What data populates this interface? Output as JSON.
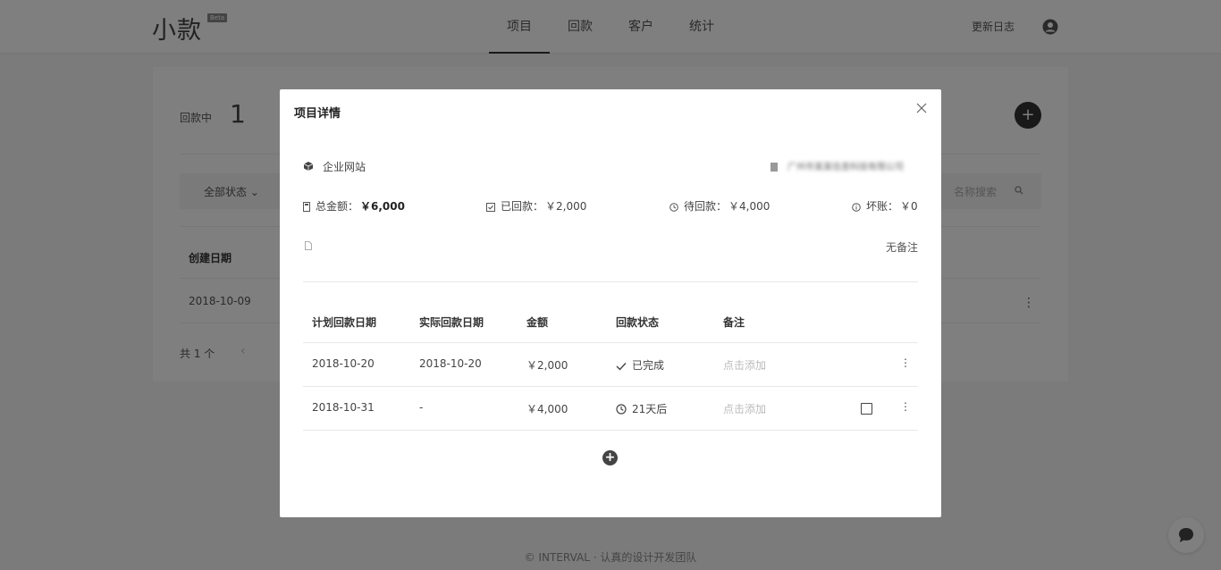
{
  "app": {
    "logo": "小款",
    "beta_badge": "Beta"
  },
  "nav": {
    "tabs": [
      {
        "label": "项目",
        "active": true
      },
      {
        "label": "回款",
        "active": false
      },
      {
        "label": "客户",
        "active": false
      },
      {
        "label": "统计",
        "active": false
      }
    ],
    "changelog": "更新日志",
    "user_icon": "user-circle-icon"
  },
  "page": {
    "in_progress_label": "回款中",
    "in_progress_count": "1",
    "status_filter": "全部状态",
    "search_placeholder": "名称搜索",
    "table": {
      "col_created": "创建日期",
      "rows": [
        {
          "created": "2018-10-09"
        }
      ]
    },
    "total": "共 1 个",
    "prev_page": "‹"
  },
  "footer": "© INTERVAL · 认真的设计开发团队",
  "modal": {
    "title": "项目详情",
    "project_name": "企业网站",
    "client_name": "广州市某某信息科技有限公司",
    "amounts": {
      "total_label": "总金额：",
      "total_value": "￥6,000",
      "received_label": "已回款：",
      "received_value": "￥2,000",
      "pending_label": "待回款：",
      "pending_value": "￥4,000",
      "bad_debt_label": "坏账：",
      "bad_debt_value": "￥0"
    },
    "note_empty": "无备注",
    "payments": {
      "headers": {
        "planned_date": "计划回款日期",
        "actual_date": "实际回款日期",
        "amount": "金额",
        "status": "回款状态",
        "remark": "备注"
      },
      "rows": [
        {
          "planned_date": "2018-10-20",
          "actual_date": "2018-10-20",
          "amount": "￥2,000",
          "status": "已完成",
          "status_icon": "check-icon",
          "remark": "点击添加",
          "has_checkbox": false
        },
        {
          "planned_date": "2018-10-31",
          "actual_date": "-",
          "amount": "￥4,000",
          "status": "21天后",
          "status_icon": "clock-icon",
          "remark": "点击添加",
          "has_checkbox": true
        }
      ]
    }
  }
}
